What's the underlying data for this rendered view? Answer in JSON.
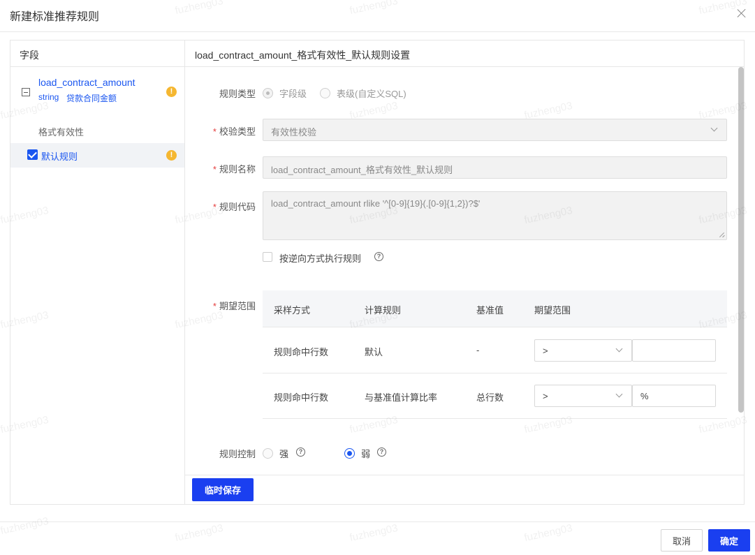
{
  "dialog": {
    "title": "新建标准推荐规则"
  },
  "left_panel": {
    "header": "字段",
    "field": {
      "name": "load_contract_amount",
      "type": "string",
      "desc": "贷款合同金额"
    },
    "group_label": "格式有效性",
    "rule_item": "默认规则",
    "warn_glyph": "!"
  },
  "right_panel": {
    "header": "load_contract_amount_格式有效性_默认规则设置",
    "form": {
      "rule_type": {
        "label": "规则类型",
        "options": [
          "字段级",
          "表级(自定义SQL)"
        ],
        "selected": "字段级"
      },
      "check_type": {
        "label": "校验类型",
        "value": "有效性校验"
      },
      "rule_name": {
        "label": "规则名称",
        "value": "load_contract_amount_格式有效性_默认规则"
      },
      "rule_code": {
        "label": "规则代码",
        "value": "load_contract_amount rlike '^[0-9]{19}(.[0-9]{1,2})?$'"
      },
      "reverse_exec": {
        "label": "按逆向方式执行规则",
        "checked": false
      },
      "expect_range": {
        "label": "期望范围",
        "columns": [
          "采样方式",
          "计算规则",
          "基准值",
          "期望范围"
        ],
        "rows": [
          {
            "sample": "规则命中行数",
            "calc": "默认",
            "base": "-",
            "operator": ">",
            "value": ""
          },
          {
            "sample": "规则命中行数",
            "calc": "与基准值计算比率",
            "base": "总行数",
            "operator": ">",
            "value": "%"
          }
        ]
      },
      "rule_control": {
        "label": "规则控制",
        "options": [
          "强",
          "弱"
        ],
        "selected": "弱"
      }
    },
    "temp_save": "临时保存"
  },
  "footer": {
    "cancel": "取消",
    "ok": "确定"
  },
  "watermark": "fuzheng03",
  "help_glyph": "?",
  "required_mark": "*",
  "colors": {
    "primary": "#1a3ff0",
    "link": "#1a56f0",
    "warning": "#f5b731",
    "required": "#e43c3c"
  }
}
